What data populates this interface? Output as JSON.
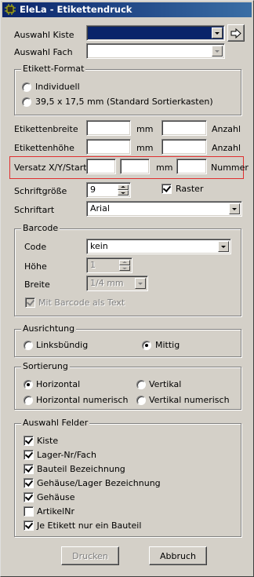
{
  "window": {
    "title": "EleLa - Etikettendruck"
  },
  "auswahl_kiste": {
    "label": "Auswahl Kiste",
    "value": "",
    "selected_color": "#0a246a"
  },
  "auswahl_fach": {
    "label": "Auswahl Fach",
    "value": ""
  },
  "etikett_format": {
    "legend": "Etikett-Format",
    "options": [
      "Individuell",
      "39,5 x 17,5 mm (Standard Sortierkasten)"
    ],
    "selected": null
  },
  "etikettenbreite": {
    "label": "Etikettenbreite",
    "mm_value": "",
    "unit": "mm",
    "anzahl_value": "",
    "anzahl_label": "Anzahl"
  },
  "etikettenhoehe": {
    "label": "Etikettenhöhe",
    "mm_value": "",
    "unit": "mm",
    "anzahl_value": "",
    "anzahl_label": "Anzahl"
  },
  "versatz": {
    "label": "Versatz X/Y/Start",
    "x_value": "",
    "y_value": "",
    "unit": "mm",
    "start_value": "",
    "nummer_label": "Nummer",
    "highlight_color": "#e03030"
  },
  "schriftgroesse": {
    "label": "Schriftgröße",
    "value": "9"
  },
  "raster": {
    "label": "Raster",
    "checked": true
  },
  "schriftart": {
    "label": "Schriftart",
    "value": "Arial"
  },
  "barcode": {
    "legend": "Barcode",
    "code_label": "Code",
    "code_value": "kein",
    "hoehe_label": "Höhe",
    "hoehe_value": "1",
    "breite_label": "Breite",
    "breite_value": "1/4 mm",
    "mit_barcode_label": "Mit Barcode als Text",
    "mit_barcode_checked": true
  },
  "ausrichtung": {
    "legend": "Ausrichtung",
    "options": [
      "Linksbündig",
      "Mittig"
    ],
    "selected": "Mittig"
  },
  "sortierung": {
    "legend": "Sortierung",
    "options": [
      "Horizontal",
      "Vertikal",
      "Horizontal numerisch",
      "Vertikal numerisch"
    ],
    "selected": "Horizontal"
  },
  "auswahl_felder": {
    "legend": "Auswahl Felder",
    "items": [
      {
        "label": "Kiste",
        "checked": true
      },
      {
        "label": "Lager-Nr/Fach",
        "checked": true
      },
      {
        "label": "Bauteil Bezeichnung",
        "checked": true
      },
      {
        "label": "Gehäuse/Lager Bezeichnung",
        "checked": true
      },
      {
        "label": "Gehäuse",
        "checked": true
      },
      {
        "label": "ArtikelNr",
        "checked": false
      },
      {
        "label": "Je Etikett nur ein Bauteil",
        "checked": true
      }
    ]
  },
  "buttons": {
    "drucken": "Drucken",
    "abbruch": "Abbruch"
  }
}
